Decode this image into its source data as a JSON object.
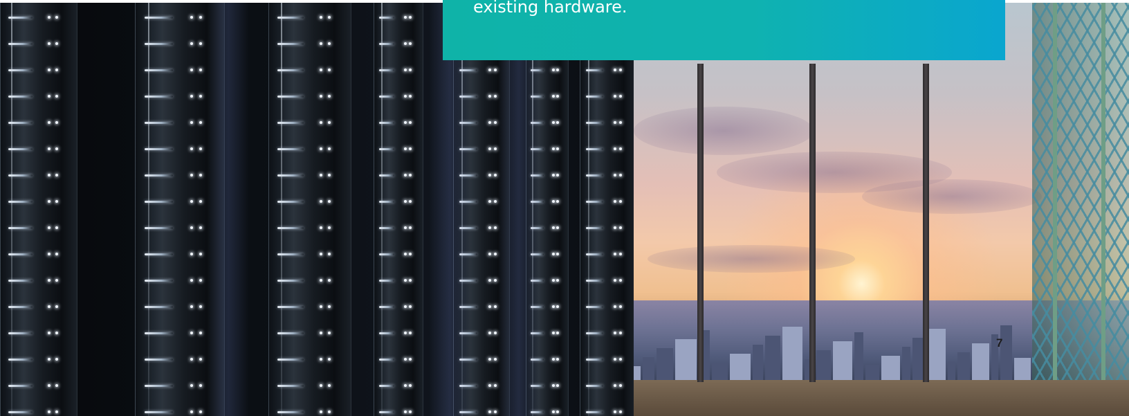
{
  "banner": {
    "text": "existing hardware."
  },
  "page_number": "7",
  "colors": {
    "banner_start": "#0fb3a8",
    "banner_end": "#0aa6cf",
    "banner_text": "#ffffff"
  }
}
